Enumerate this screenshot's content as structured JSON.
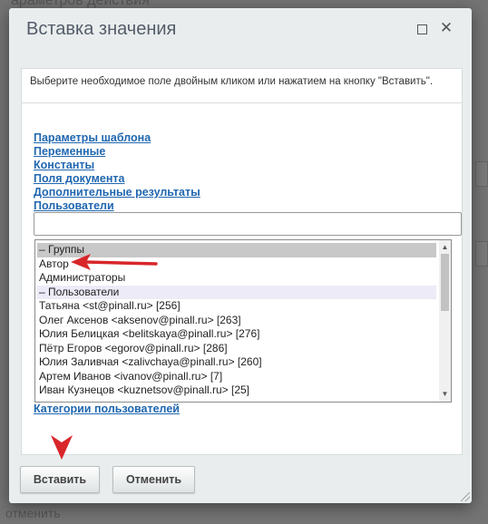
{
  "background": {
    "title_fragment": "араметров действия",
    "bottom_fragment": "отменить"
  },
  "dialog": {
    "title": "Вставка значения",
    "hint": "Выберите необходимое поле двойным кликом или нажатием на кнопку \"Вставить\".",
    "links": [
      "Параметры шаблона",
      "Переменные",
      "Константы",
      "Поля документа",
      "Дополнительные результаты",
      "Пользователи"
    ],
    "search_value": "",
    "list": [
      {
        "label": "– Группы",
        "kind": "group-selected"
      },
      {
        "label": "Автор",
        "kind": "item"
      },
      {
        "label": "Администраторы",
        "kind": "item"
      },
      {
        "label": "– Пользователи",
        "kind": "group"
      },
      {
        "label": "Татьяна <st@pinall.ru> [256]",
        "kind": "item"
      },
      {
        "label": "Олег Аксенов <aksenov@pinall.ru> [263]",
        "kind": "item"
      },
      {
        "label": "Юлия Белицкая <belitskaya@pinall.ru> [276]",
        "kind": "item"
      },
      {
        "label": "Пётр Егоров <egorov@pinall.ru> [286]",
        "kind": "item"
      },
      {
        "label": "Юлия Заливчая <zalivchaya@pinall.ru> [260]",
        "kind": "item"
      },
      {
        "label": "Артем Иванов <ivanov@pinall.ru> [7]",
        "kind": "item"
      },
      {
        "label": "Иван Кузнецов <kuznetsov@pinall.ru> [25]",
        "kind": "item"
      }
    ],
    "category_link": "Категории пользователей",
    "buttons": {
      "insert": "Вставить",
      "cancel": "Отменить"
    },
    "scroll_position": 0.0
  },
  "colors": {
    "link": "#2067b0",
    "annotation_arrow": "#d8262a"
  },
  "icons": {
    "maximize": "maximize-icon",
    "close": "close-icon",
    "scroll_up": "scroll-up-icon",
    "scroll_down": "scroll-down-icon"
  }
}
